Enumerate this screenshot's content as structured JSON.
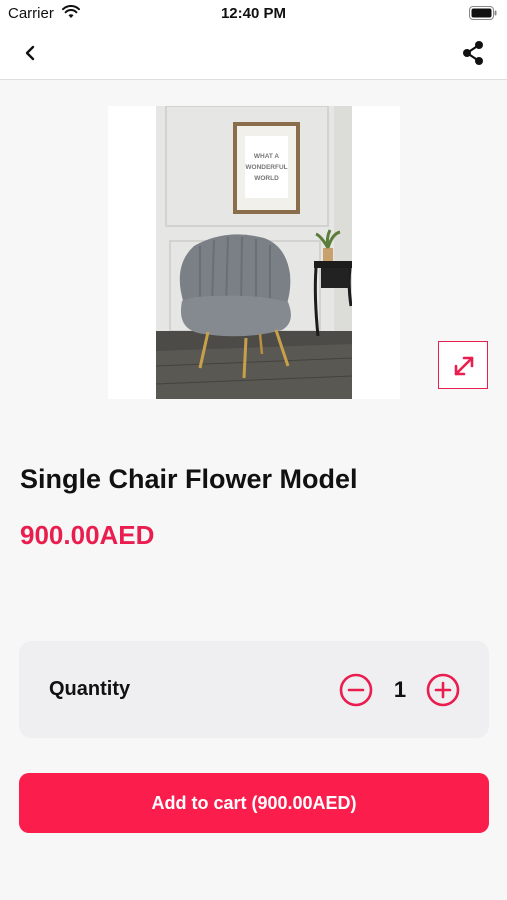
{
  "status_bar": {
    "carrier": "Carrier",
    "time": "12:40 PM"
  },
  "nav": {
    "back_icon": "chevron-left-icon",
    "share_icon": "share-icon"
  },
  "product": {
    "image_alt": "Grey velvet shell-back chair",
    "frame_text": "WHAT A WONDERFUL WORLD",
    "title": "Single Chair Flower Model",
    "price": "900.00AED"
  },
  "quantity": {
    "label": "Quantity",
    "value": "1"
  },
  "cart_button": {
    "label": "Add to cart (900.00AED)"
  },
  "colors": {
    "accent": "#e91e4f",
    "button": "#fb1d4c",
    "background": "#f7f7f7",
    "card": "#efeff2"
  }
}
